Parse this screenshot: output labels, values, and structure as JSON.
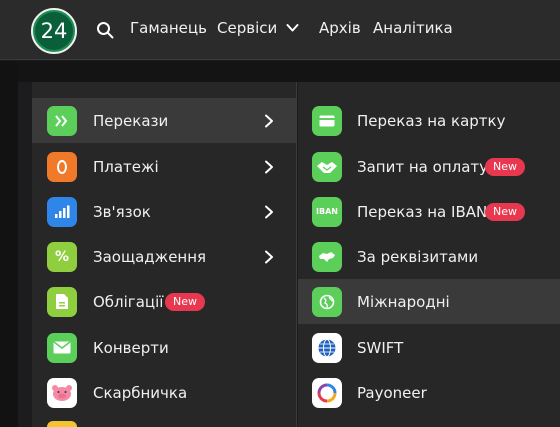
{
  "topbar": {
    "logo_text": "24",
    "nav": {
      "wallet": "Гаманець",
      "services": "Сервіси",
      "archive": "Архів",
      "analytics": "Аналітика"
    }
  },
  "colors": {
    "green": "#5ccf5a",
    "orange": "#f07a2a",
    "blue": "#2f86e8",
    "lime": "#8fcf3f",
    "badge_red": "#e8384f",
    "active_row": "#3a3a3a"
  },
  "left_menu": [
    {
      "label": "Перекази",
      "icon": "transfer-arrows-icon",
      "chevron": true,
      "active": true
    },
    {
      "label": "Платежі",
      "icon": "payment-coin-icon",
      "chevron": true
    },
    {
      "label": "Зв'язок",
      "icon": "signal-bars-icon",
      "chevron": true
    },
    {
      "label": "Заощадження",
      "icon": "percent-icon",
      "chevron": true
    },
    {
      "label": "Облігації",
      "icon": "document-icon",
      "badge": "New"
    },
    {
      "label": "Конверти",
      "icon": "envelope-icon"
    },
    {
      "label": "Скарбничка",
      "icon": "piggy-bank-icon"
    }
  ],
  "right_menu": [
    {
      "label": "Переказ на картку",
      "icon": "card-icon"
    },
    {
      "label": "Запит на оплату",
      "icon": "handshake-icon",
      "badge": "New"
    },
    {
      "label": "Переказ на IBAN",
      "icon": "iban-icon",
      "icon_text": "IBAN",
      "badge": "New"
    },
    {
      "label": "За реквізитами",
      "icon": "map-icon"
    },
    {
      "label": "Міжнародні",
      "icon": "globe-icon",
      "active": true
    },
    {
      "label": "SWIFT",
      "icon": "swift-globe-icon"
    },
    {
      "label": "Payoneer",
      "icon": "payoneer-icon"
    }
  ]
}
